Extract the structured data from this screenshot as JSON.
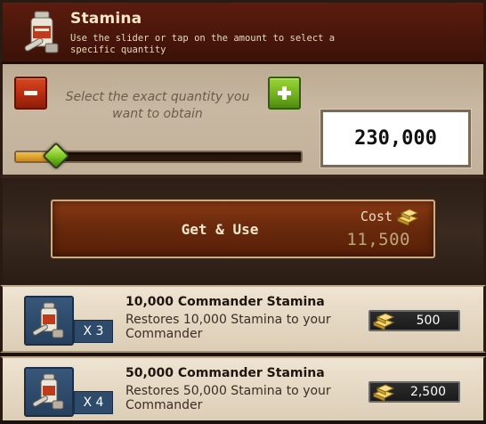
{
  "header": {
    "title": "Stamina",
    "description": "Use the slider or tap on the amount to select a specific quantity",
    "icon": "stamina-bottle-icon"
  },
  "selector": {
    "hint": "Select the exact quantity you want to obtain",
    "quantity": "230,000",
    "slider_fraction": 0.14,
    "decrease_icon": "minus-icon",
    "increase_icon": "plus-icon"
  },
  "action": {
    "label": "Get & Use",
    "cost_label": "Cost",
    "cost_value": "11,500",
    "cost_icon": "gold-bars-icon"
  },
  "items": [
    {
      "title": "10,000 Commander Stamina",
      "description": "Restores 10,000 Stamina to your Commander",
      "count": "X 3",
      "price": "500",
      "icon": "stamina-bottle-icon"
    },
    {
      "title": "50,000 Commander Stamina",
      "description": "Restores 50,000 Stamina to your Commander",
      "count": "X 4",
      "price": "2,500",
      "icon": "stamina-bottle-icon"
    }
  ],
  "colors": {
    "header_bg": "#4a160b",
    "panel_bg": "#c2b19a",
    "plus_green": "#6fae1c",
    "minus_red": "#b02a10",
    "button_bg": "#6a2a0c"
  }
}
